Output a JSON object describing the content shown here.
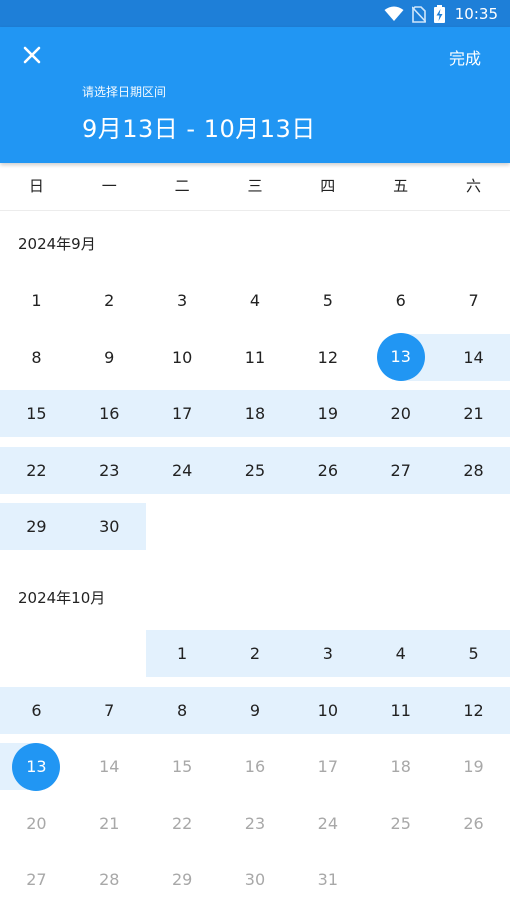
{
  "status_bar": {
    "time": "10:35",
    "icons": [
      "wifi-icon",
      "no-sim-icon",
      "battery-charging-icon"
    ]
  },
  "header": {
    "close_icon": "close-icon",
    "done_label": "完成",
    "subtitle": "请选择日期区间",
    "range_text": "9月13日 - 10月13日"
  },
  "weekdays": [
    "日",
    "一",
    "二",
    "三",
    "四",
    "五",
    "六"
  ],
  "months": [
    {
      "title": "2024年9月",
      "first_weekday": 0,
      "days": 30,
      "selected_start": 13,
      "disabled_from": 0
    },
    {
      "title": "2024年10月",
      "first_weekday": 2,
      "days": 31,
      "selected_end": 13,
      "disabled_from": 14
    }
  ],
  "colors": {
    "accent": "#2196f3",
    "status_bar": "#1e7fd8",
    "range_band": "#e3f1fd",
    "disabled_text": "#a8a8a8"
  }
}
